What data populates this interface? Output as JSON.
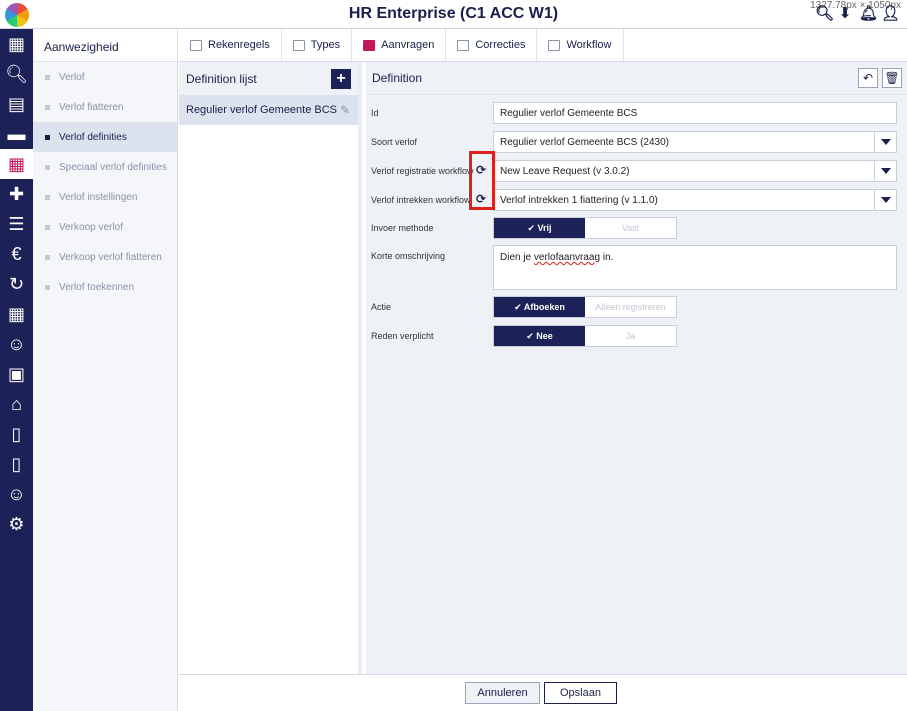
{
  "app": {
    "title": "HR Enterprise (C1 ACC W1)",
    "dims": "1327.78px × 1050px"
  },
  "top_icons": [
    "search-icon",
    "download-icon",
    "bell-icon",
    "user-icon"
  ],
  "rail": [
    "grid-icon",
    "search-icon",
    "id-card-icon",
    "folder-icon",
    "calendar-icon",
    "medkit-icon",
    "tasks-icon",
    "money-bag-icon",
    "euro-cycle-icon",
    "schedule-icon",
    "person-icon",
    "badge-icon",
    "bank-icon",
    "document-icon",
    "document-list-icon",
    "hand-user-icon",
    "gear-icon"
  ],
  "nav": {
    "title": "Aanwezigheid",
    "items": [
      {
        "label": "Verlof",
        "active": false
      },
      {
        "label": "Verlof fiatteren",
        "active": false
      },
      {
        "label": "Verlof definities",
        "active": true
      },
      {
        "label": "Speciaal verlof definities",
        "active": false
      },
      {
        "label": "Verlof instellingen",
        "active": false
      },
      {
        "label": "Verkoop verlof",
        "active": false
      },
      {
        "label": "Verkoop verlof fiatteren",
        "active": false
      },
      {
        "label": "Verlof toekennen",
        "active": false
      }
    ]
  },
  "tabs": [
    {
      "label": "Rekenregels",
      "active": false
    },
    {
      "label": "Types",
      "active": false
    },
    {
      "label": "Aanvragen",
      "active": true
    },
    {
      "label": "Correcties",
      "active": false
    },
    {
      "label": "Workflow",
      "active": false
    }
  ],
  "deflist": {
    "title": "Definition lijst",
    "item": "Regulier verlof Gemeente BCS"
  },
  "detail": {
    "title": "Definition",
    "id_label": "Id",
    "id_value": "Regulier verlof Gemeente BCS",
    "soort_label": "Soort verlof",
    "soort_value": "Regulier verlof Gemeente BCS (2430)",
    "reg_label": "Verlof registratie workflow",
    "reg_value": "New Leave Request (v 3.0.2)",
    "intr_label": "Verlof intrekken workflow",
    "intr_value": "Verlof intrekken 1 fiattering (v 1.1.0)",
    "invoer_label": "Invoer methode",
    "invoer_opt1": "✔ Vrij",
    "invoer_opt2": "Vast",
    "omschrijving_label": "Korte omschrijving",
    "omschrijving_pre": "Dien je ",
    "omschrijving_squig": "verlofaanvraag",
    "omschrijving_post": " in.",
    "actie_label": "Actie",
    "actie_opt1": "✔ Afboeken",
    "actie_opt2": "Alleen registreren",
    "reden_label": "Reden verplicht",
    "reden_opt1": "✔ Nee",
    "reden_opt2": "Ja"
  },
  "footer": {
    "cancel": "Annuleren",
    "save": "Opslaan"
  },
  "colors": {
    "navy": "#1c2158",
    "accent": "#c2185b",
    "highlight": "#e0201b"
  }
}
